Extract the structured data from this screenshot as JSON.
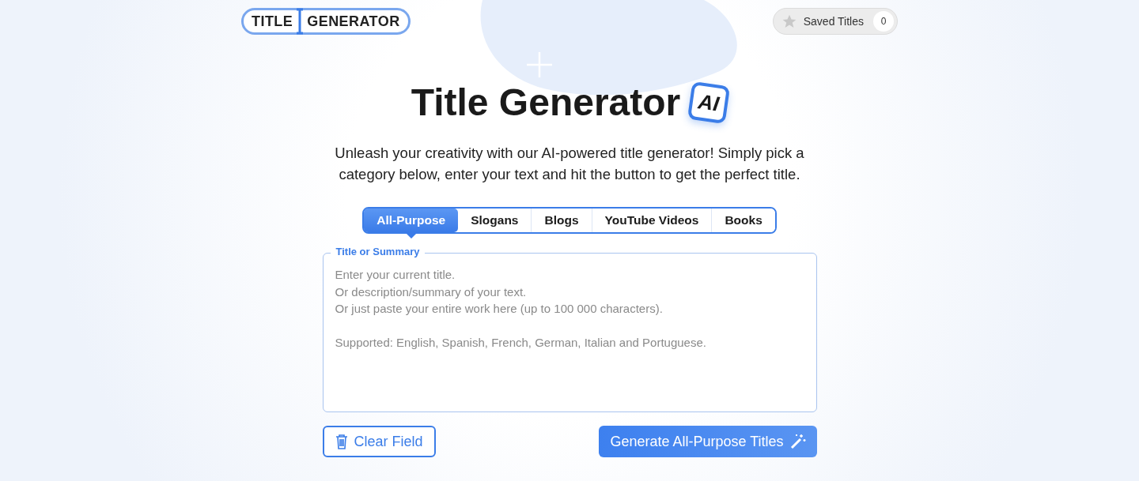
{
  "logo": {
    "left": "TITLE",
    "right": "GENERATOR"
  },
  "saved": {
    "label": "Saved Titles",
    "count": "0"
  },
  "hero": {
    "title": "Title Generator",
    "badge": "AI",
    "subtitle": "Unleash your creativity with our AI-powered title generator! Simply pick a category below, enter your text and hit the button to get the perfect title."
  },
  "tabs": [
    {
      "label": "All-Purpose",
      "selected": true
    },
    {
      "label": "Slogans",
      "selected": false
    },
    {
      "label": "Blogs",
      "selected": false
    },
    {
      "label": "YouTube Videos",
      "selected": false
    },
    {
      "label": "Books",
      "selected": false
    }
  ],
  "field": {
    "label": "Title or Summary",
    "placeholder": "Enter your current title.\nOr description/summary of your text.\nOr just paste your entire work here (up to 100 000 characters).\n\nSupported: English, Spanish, French, German, Italian and Portuguese."
  },
  "buttons": {
    "clear": "Clear Field",
    "generate": "Generate All-Purpose Titles"
  }
}
